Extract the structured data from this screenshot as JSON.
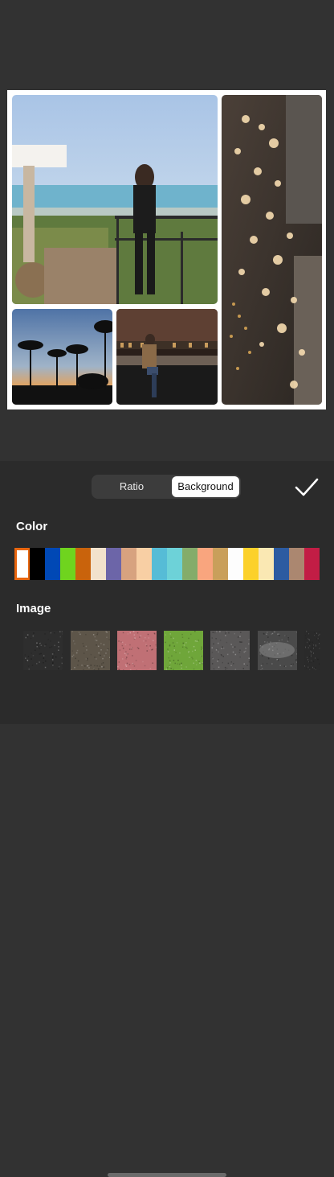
{
  "tabs": {
    "ratio_label": "Ratio",
    "background_label": "Background",
    "active": "Background"
  },
  "sections": {
    "color_label": "Color",
    "image_label": "Image"
  },
  "colors": {
    "selected_index": 0,
    "swatches": [
      "#ffffff",
      "#000000",
      "#0048b5",
      "#6fd41e",
      "#c9630c",
      "#f2e2cc",
      "#6c65a8",
      "#d7a27f",
      "#f8cfa4",
      "#56bcd6",
      "#6dd2d8",
      "#84ac6a",
      "#f9a57e",
      "#c99f5b",
      "#fdfdfd",
      "#fcd12a",
      "#fae8b3",
      "#2c5ba1",
      "#ab8770",
      "#c21d45"
    ]
  },
  "textures": [
    {
      "name": "dark-charcoal",
      "color": "#2e2e2e"
    },
    {
      "name": "brown-granite",
      "color": "#5d5549"
    },
    {
      "name": "pink-speckle",
      "color": "#c07075"
    },
    {
      "name": "green-grass",
      "color": "#6fa63a"
    },
    {
      "name": "grey-stone",
      "color": "#5a5858"
    },
    {
      "name": "dark-blur",
      "color": "#4a4a4a"
    },
    {
      "name": "black-mesh",
      "color": "#2a2a2a"
    }
  ],
  "accent": "#e8660f",
  "icons": {
    "confirm": "checkmark-icon"
  }
}
